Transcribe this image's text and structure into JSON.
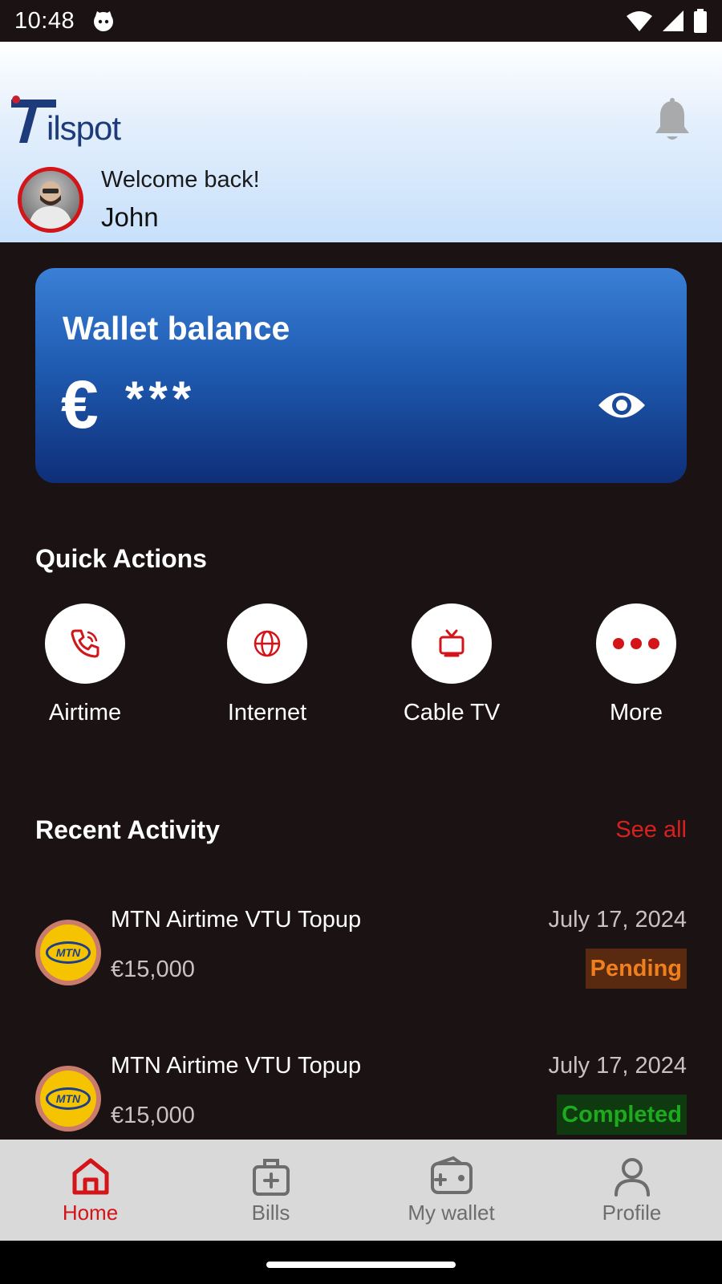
{
  "status_bar": {
    "time": "10:48"
  },
  "header": {
    "logo_text": "ilspot",
    "welcome": "Welcome back!",
    "username": "John"
  },
  "wallet": {
    "title": "Wallet balance",
    "currency": "€",
    "masked_balance": "***"
  },
  "quick_actions": {
    "title": "Quick Actions",
    "items": [
      {
        "label": "Airtime",
        "icon": "phone-icon"
      },
      {
        "label": "Internet",
        "icon": "globe-icon"
      },
      {
        "label": "Cable TV",
        "icon": "tv-icon"
      },
      {
        "label": "More",
        "icon": "more-dots-icon"
      }
    ]
  },
  "recent_activity": {
    "title": "Recent Activity",
    "see_all": "See all",
    "items": [
      {
        "logo_text": "MTN",
        "title": "MTN Airtime VTU Topup",
        "amount": "€15,000",
        "date": "July 17, 2024",
        "status": "Pending"
      },
      {
        "logo_text": "MTN",
        "title": "MTN Airtime VTU Topup",
        "amount": "€15,000",
        "date": "July 17, 2024",
        "status": "Completed"
      }
    ]
  },
  "bottom_nav": {
    "items": [
      {
        "label": "Home",
        "icon": "home-icon",
        "active": true
      },
      {
        "label": "Bills",
        "icon": "bills-icon",
        "active": false
      },
      {
        "label": "My wallet",
        "icon": "wallet-icon",
        "active": false
      },
      {
        "label": "Profile",
        "icon": "profile-icon",
        "active": false
      }
    ]
  },
  "colors": {
    "accent": "#d31418",
    "background": "#1b1213",
    "pending": "#f07f1e",
    "completed": "#1eaa1e"
  }
}
